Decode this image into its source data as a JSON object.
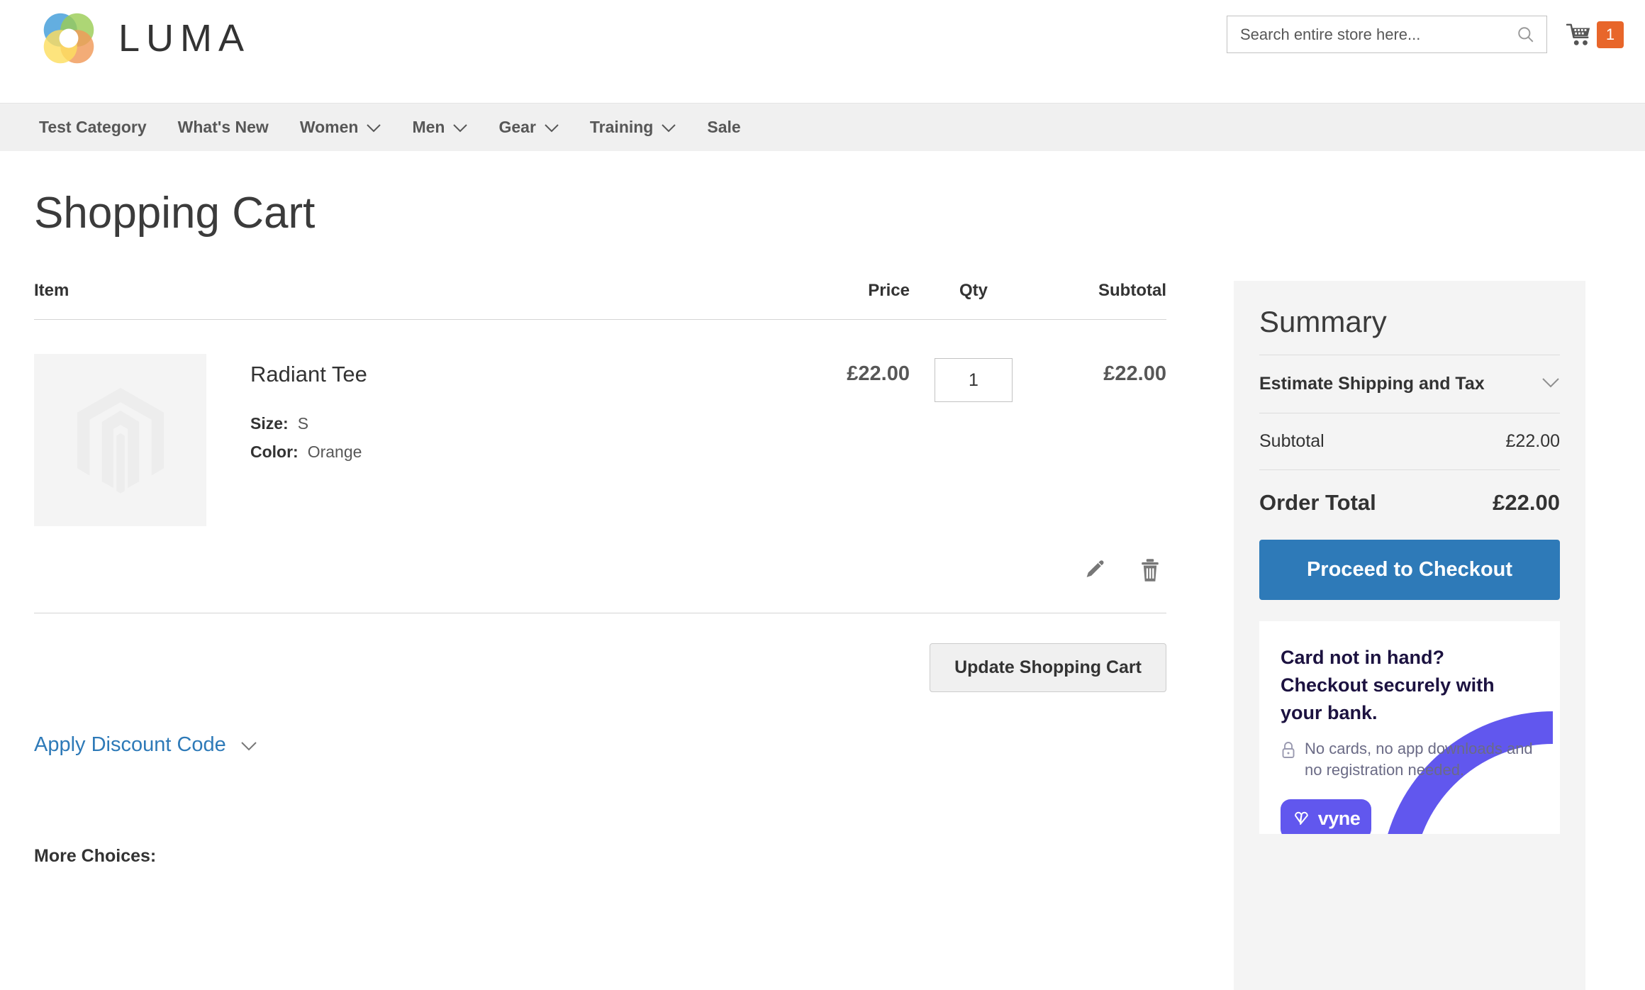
{
  "header": {
    "brand": "LUMA",
    "logo_icon": "luma-rings-logo",
    "search": {
      "placeholder": "Search entire store here...",
      "value": "",
      "icon": "search-icon"
    },
    "cart": {
      "icon": "shopping-cart-icon",
      "count": "1",
      "badge_color": "#e8662a"
    }
  },
  "nav": {
    "items": [
      {
        "label": "Test Category",
        "has_dropdown": false
      },
      {
        "label": "What's New",
        "has_dropdown": false
      },
      {
        "label": "Women",
        "has_dropdown": true
      },
      {
        "label": "Men",
        "has_dropdown": true
      },
      {
        "label": "Gear",
        "has_dropdown": true
      },
      {
        "label": "Training",
        "has_dropdown": true
      },
      {
        "label": "Sale",
        "has_dropdown": false
      }
    ]
  },
  "page": {
    "title": "Shopping Cart"
  },
  "cart": {
    "columns": {
      "item": "Item",
      "price": "Price",
      "qty": "Qty",
      "subtotal": "Subtotal"
    },
    "items": [
      {
        "name": "Radiant Tee",
        "thumb_icon": "magento-placeholder-icon",
        "price": "£22.00",
        "qty": "1",
        "subtotal": "£22.00",
        "options": [
          {
            "label": "Size:",
            "value": "S"
          },
          {
            "label": "Color:",
            "value": "Orange"
          }
        ],
        "actions": {
          "edit_icon": "pencil-icon",
          "remove_icon": "trash-icon"
        }
      }
    ],
    "update_button": "Update Shopping Cart",
    "discount_link": "Apply Discount Code",
    "discount_chevron": "chevron-down-icon",
    "more_choices": "More Choices:"
  },
  "summary": {
    "title": "Summary",
    "shipping_label": "Estimate Shipping and Tax",
    "shipping_chevron": "chevron-down-icon",
    "lines": [
      {
        "label": "Subtotal",
        "value": "£22.00"
      }
    ],
    "order_total_label": "Order Total",
    "order_total_value": "£22.00",
    "checkout_button": "Proceed to Checkout",
    "checkout_color": "#2e7ab8"
  },
  "vyne": {
    "headline_line1": "Card not in hand?",
    "headline_line2": "Checkout securely with your bank.",
    "lock_icon": "lock-icon",
    "subtext": "No cards, no app downloads and no registration needed.",
    "logo_text": "vyne",
    "logo_icon": "vyne-heart-icon",
    "brand_color": "#6157ee"
  }
}
